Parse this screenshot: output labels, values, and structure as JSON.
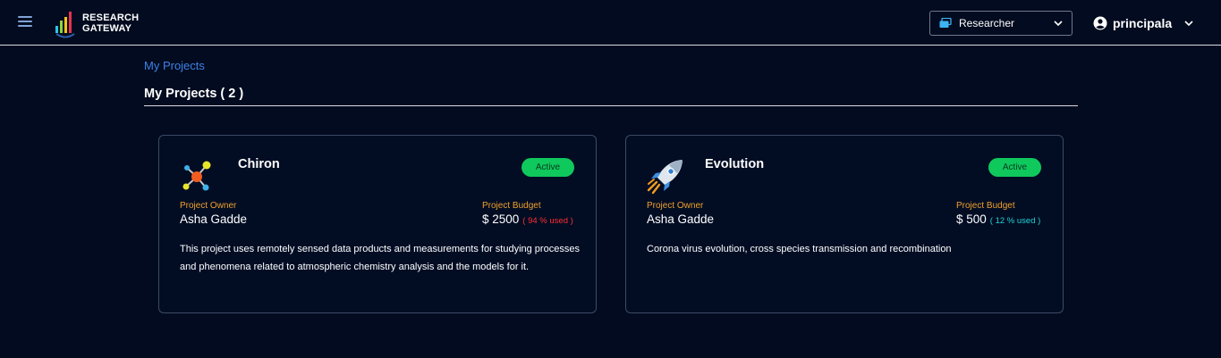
{
  "header": {
    "logo_line1": "RESEARCH",
    "logo_line2": "GATEWAY",
    "role_label": "Researcher",
    "username": "principala"
  },
  "breadcrumb": "My Projects",
  "page_title": "My Projects ( 2 )",
  "labels": {
    "owner": "Project Owner",
    "budget": "Project Budget"
  },
  "projects": [
    {
      "name": "Chiron",
      "status": "Active",
      "owner": "Asha Gadde",
      "budget": "$ 2500",
      "used": "( 94 % used )",
      "used_color": "#ff2d2d",
      "icon": "molecule-icon",
      "description": "This project uses remotely sensed data products and measurements for studying processes and phenomena related to atmospheric chemistry analysis and the models for it."
    },
    {
      "name": "Evolution",
      "status": "Active",
      "owner": "Asha Gadde",
      "budget": "$ 500",
      "used": "( 12 % used )",
      "used_color": "#22d3d3",
      "icon": "rocket-icon",
      "description": "Corona virus evolution, cross species transmission and recombination"
    }
  ],
  "colors": {
    "background": "#020b1f",
    "accent": "#3d82e8",
    "status_active": "#0fc95c",
    "label_orange": "#f0a02a"
  }
}
